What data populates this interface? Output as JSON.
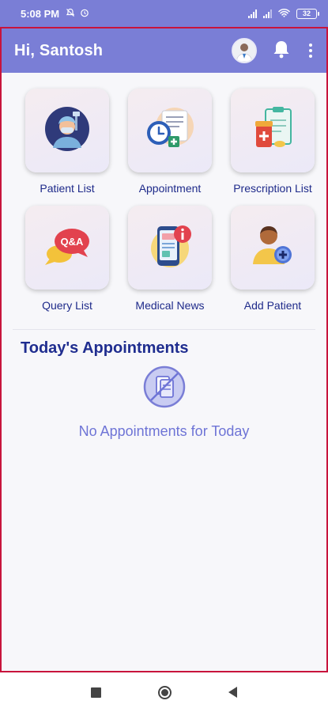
{
  "status_bar": {
    "time": "5:08 PM",
    "battery": "32",
    "icons": [
      "mute-icon",
      "alarm-icon",
      "signal-icon",
      "signal-icon",
      "wifi-icon",
      "battery-icon"
    ]
  },
  "app_bar": {
    "greeting": "Hi, Santosh",
    "icons": [
      "avatar",
      "bell-icon",
      "more-vert-icon"
    ]
  },
  "menu": [
    {
      "label": "Patient List",
      "icon": "doctor-icon"
    },
    {
      "label": "Appointment",
      "icon": "clock-calendar-icon"
    },
    {
      "label": "Prescription List",
      "icon": "clipboard-pill-icon"
    },
    {
      "label": "Query List",
      "icon": "chat-bubble-icon",
      "icon_text": "Q&A"
    },
    {
      "label": "Medical News",
      "icon": "phone-info-icon"
    },
    {
      "label": "Add Patient",
      "icon": "add-person-icon"
    }
  ],
  "appointments": {
    "title": "Today's Appointments",
    "empty_text": "No Appointments for Today",
    "icon": "no-document-icon"
  },
  "colors": {
    "primary": "#7a7ed6",
    "title": "#1f2d8f",
    "label": "#1e2a8a",
    "empty_text": "#6e74d6",
    "frame_border": "#c8143c"
  },
  "nav_bar": {
    "icons": [
      "recents-icon",
      "home-icon",
      "back-icon"
    ]
  }
}
